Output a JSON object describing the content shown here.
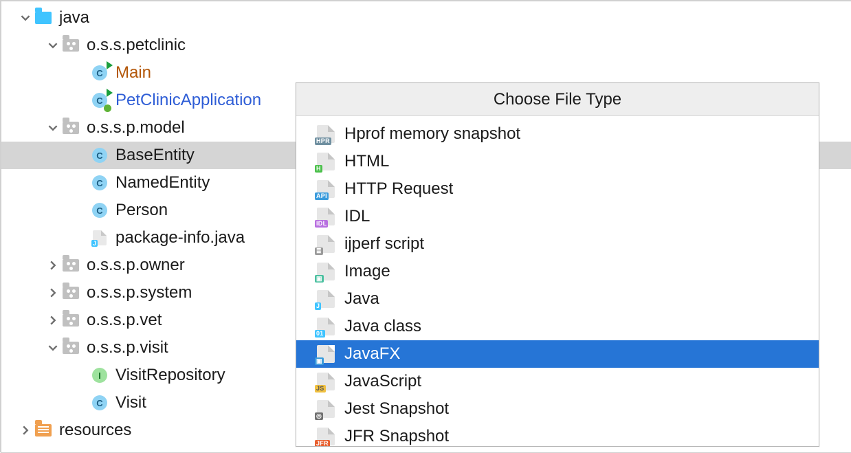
{
  "tree": {
    "java": "java",
    "petclinic": "o.s.s.petclinic",
    "main": "Main",
    "app": "PetClinicApplication",
    "model": "o.s.s.p.model",
    "baseEntity": "BaseEntity",
    "namedEntity": "NamedEntity",
    "person": "Person",
    "packageInfo": "package-info.java",
    "owner": "o.s.s.p.owner",
    "system": "o.s.s.p.system",
    "vet": "o.s.s.p.vet",
    "visitPkg": "o.s.s.p.visit",
    "visitRepo": "VisitRepository",
    "visit": "Visit",
    "resources": "resources"
  },
  "popup": {
    "title": "Choose File Type",
    "items": [
      {
        "label": "Hprof memory snapshot",
        "badgeText": "HPR",
        "badgeBg": "#6f8fa0",
        "badgeColor": "#fff"
      },
      {
        "label": "HTML",
        "badgeText": "H",
        "badgeBg": "#4bc04b",
        "badgeColor": "#fff"
      },
      {
        "label": "HTTP Request",
        "badgeText": "API",
        "badgeBg": "#3a9bdc",
        "badgeColor": "#fff"
      },
      {
        "label": "IDL",
        "badgeText": "IDL",
        "badgeBg": "#b86fe0",
        "badgeColor": "#fff"
      },
      {
        "label": "ijperf script",
        "badgeText": "≣",
        "badgeBg": "#9a9a9a",
        "badgeColor": "#fff"
      },
      {
        "label": "Image",
        "badgeText": "▣",
        "badgeBg": "#4bc0a0",
        "badgeColor": "#fff"
      },
      {
        "label": "Java",
        "badgeText": "J",
        "badgeBg": "#40c4ff",
        "badgeColor": "#fff"
      },
      {
        "label": "Java class",
        "badgeText": "01",
        "badgeBg": "#40c4ff",
        "badgeColor": "#fff"
      },
      {
        "label": "JavaFX",
        "badgeText": "▣",
        "badgeBg": "#3a9bdc",
        "badgeColor": "#fff",
        "selected": true
      },
      {
        "label": "JavaScript",
        "badgeText": "JS",
        "badgeBg": "#f0c040",
        "badgeColor": "#555"
      },
      {
        "label": "Jest Snapshot",
        "badgeText": "◎",
        "badgeBg": "#707070",
        "badgeColor": "#fff"
      },
      {
        "label": "JFR Snapshot",
        "badgeText": "JFR",
        "badgeBg": "#e86030",
        "badgeColor": "#fff"
      }
    ]
  }
}
